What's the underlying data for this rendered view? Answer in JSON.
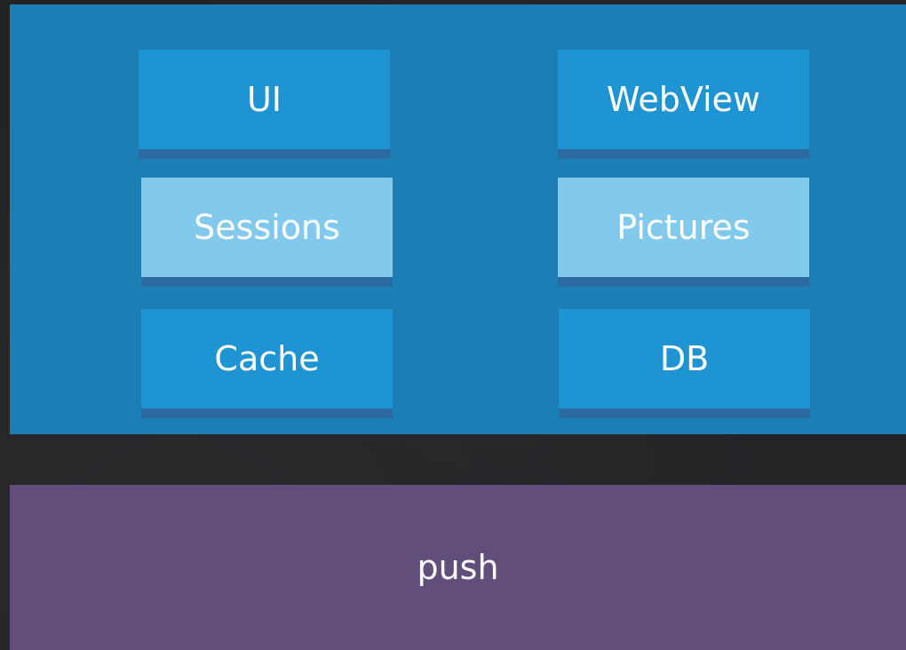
{
  "app_panel": {
    "modules": {
      "ui": "UI",
      "webview": "WebView",
      "sessions": "Sessions",
      "pictures": "Pictures",
      "cache": "Cache",
      "db": "DB"
    }
  },
  "push_panel": {
    "label": "push"
  },
  "colors": {
    "background": "#232326",
    "app_panel": "#1b7fb5",
    "module_dark": "#1e94d3",
    "module_light": "#82c9ee",
    "module_shadow": "#2b6aa0",
    "push_panel": "#614e7b",
    "text": "#ffffff"
  }
}
